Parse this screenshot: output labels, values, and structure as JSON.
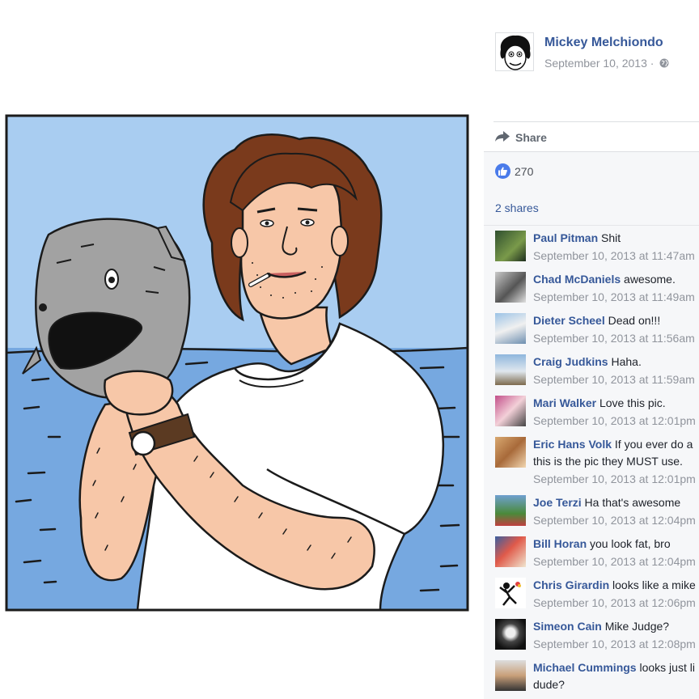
{
  "post": {
    "author_name": "Mickey Melchiondo",
    "date": "September 10, 2013",
    "meta_separator": "·",
    "privacy_icon": "globe-icon",
    "share_label": "Share",
    "likes_count": "270",
    "shares_label": "2 shares"
  },
  "colors": {
    "link": "#365899",
    "sky": "#a9cdf1",
    "sea": "#76a8e0",
    "skin": "#f7c7a8",
    "hair": "#7a3a1c",
    "fish": "#a2a2a2"
  },
  "comments": [
    {
      "name": "Paul Pitman",
      "text": "Shit",
      "time": "September 10, 2013 at 11:47am"
    },
    {
      "name": "Chad McDaniels",
      "text": "awesome.",
      "time": "September 10, 2013 at 11:49am"
    },
    {
      "name": "Dieter Scheel",
      "text": "Dead on!!!",
      "time": "September 10, 2013 at 11:56am"
    },
    {
      "name": "Craig Judkins",
      "text": "Haha.",
      "time": "September 10, 2013 at 11:59am"
    },
    {
      "name": "Mari Walker",
      "text": "Love this pic.",
      "time": "September 10, 2013 at 12:01pm"
    },
    {
      "name": "Eric Hans Volk",
      "text": "If you ever do a",
      "text2": "this is the pic they MUST use.",
      "time": "September 10, 2013 at 12:01pm"
    },
    {
      "name": "Joe Terzi",
      "text": "Ha that's awesome",
      "time": "September 10, 2013 at 12:04pm"
    },
    {
      "name": "Bill Horan",
      "text": "you look fat, bro",
      "time": "September 10, 2013 at 12:04pm"
    },
    {
      "name": "Chris Girardin",
      "text": "looks like a mike",
      "time": "September 10, 2013 at 12:06pm"
    },
    {
      "name": "Simeon Cain",
      "text": "Mike Judge?",
      "time": "September 10, 2013 at 12:08pm"
    },
    {
      "name": "Michael Cummings",
      "text": "looks just li",
      "text2": "dude?",
      "time": ""
    }
  ]
}
